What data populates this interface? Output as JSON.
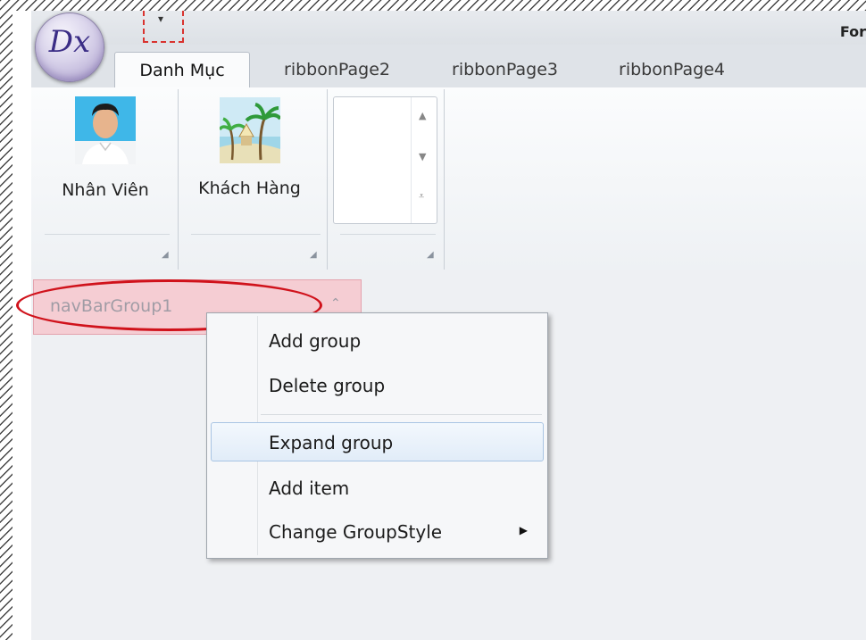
{
  "window": {
    "title": "For"
  },
  "app_button": {
    "logo": "Dx"
  },
  "quick_access": {
    "icon": "qat-customize-icon",
    "glyph": "▾"
  },
  "tabs": [
    {
      "label": "Danh Mục",
      "active": true
    },
    {
      "label": "ribbonPage2",
      "active": false
    },
    {
      "label": "ribbonPage3",
      "active": false
    },
    {
      "label": "ribbonPage4",
      "active": false
    }
  ],
  "ribbon": {
    "buttons": [
      {
        "label": "Nhân Viên",
        "icon": "employee-photo-icon"
      },
      {
        "label": "Khách Hàng",
        "icon": "customer-beach-icon"
      }
    ],
    "gallery": {
      "scroll_up": "▲",
      "scroll_down": "▼",
      "expand": "⩡"
    }
  },
  "navbar": {
    "group": {
      "label": "navBarGroup1",
      "chevron": "ˆ"
    }
  },
  "context_menu": {
    "items": [
      {
        "label": "Add group"
      },
      {
        "label": "Delete group"
      },
      {
        "label": "Expand group",
        "highlighted": true
      },
      {
        "label": "Add item"
      },
      {
        "label": "Change GroupStyle",
        "submenu": "▶"
      }
    ]
  },
  "colors": {
    "highlight_ellipse": "#d0121b",
    "nav_group_bg": "#f5cdd3",
    "menu_hover": "#e1ecf8"
  }
}
